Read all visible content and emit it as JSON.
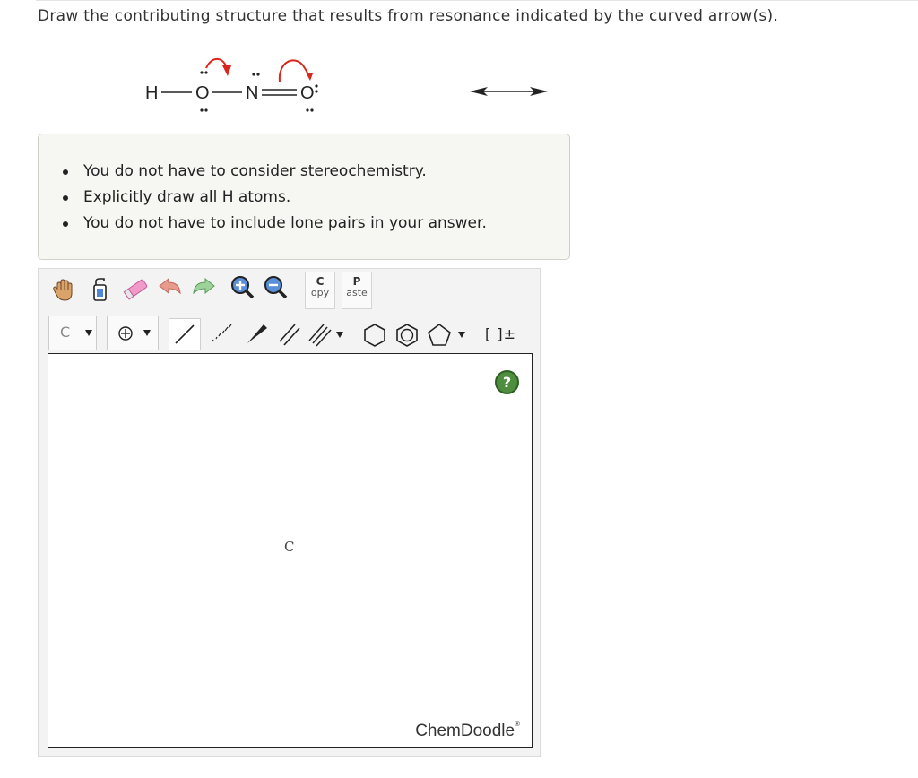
{
  "question": {
    "prompt": "Draw the contributing structure that results from resonance indicated by the curved arrow(s)."
  },
  "molecule": {
    "atoms": [
      "H",
      "O",
      "N",
      "O"
    ],
    "resonance_arrow_icon": "double-headed-arrow-icon",
    "curved_arrow_color": "#d8261c"
  },
  "instructions": {
    "items": [
      "You do not have to consider stereochemistry.",
      "Explicitly draw all H atoms.",
      "You do not have to include lone pairs in your answer."
    ]
  },
  "sketcher": {
    "toolbar_row1": [
      "hand-icon",
      "clear-icon",
      "eraser-icon",
      "undo-icon",
      "redo-icon",
      "zoom-in-icon",
      "zoom-out-icon"
    ],
    "copy": {
      "big": "C",
      "small": "opy"
    },
    "paste": {
      "big": "P",
      "small": "aste"
    },
    "element_select": "C",
    "charge_symbol": "⊕",
    "bracket_label": "[ ]±",
    "canvas_atom": "C",
    "help": "?",
    "brand": "ChemDoodle",
    "brand_mark": "®"
  },
  "colors": {
    "panel_bg": "#f6f7f3",
    "help_green": "#4f8e3e",
    "arrow_red": "#d8261c"
  }
}
